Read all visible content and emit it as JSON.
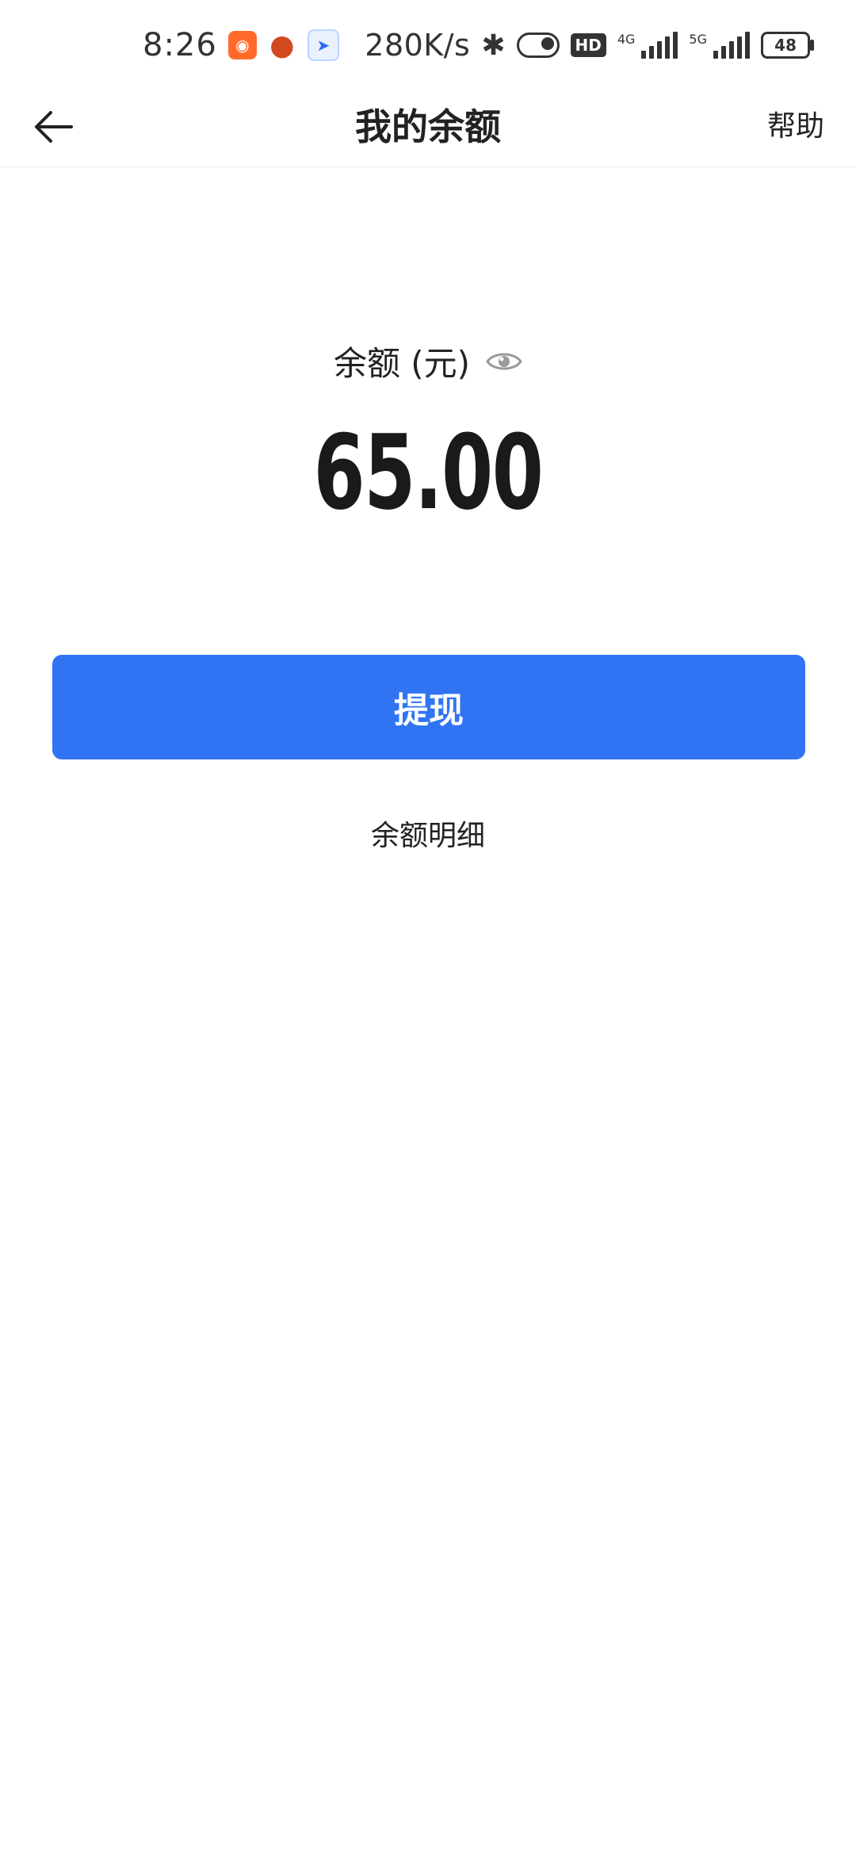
{
  "status_bar": {
    "time": "8:26",
    "net_speed": "280K/s",
    "hd_label": "HD",
    "net1_label": "4G",
    "net2_label": "5G",
    "battery": "48",
    "app_icons": [
      "mi-store-icon",
      "pumpkin-icon",
      "compass-icon"
    ]
  },
  "header": {
    "title": "我的余额",
    "help_label": "帮助"
  },
  "balance": {
    "label": "余额 (元)",
    "amount": "65.00"
  },
  "actions": {
    "withdraw_label": "提现",
    "detail_label": "余额明细"
  },
  "colors": {
    "primary": "#3074f3",
    "text": "#222222",
    "eye_icon": "#9a9a9a"
  }
}
